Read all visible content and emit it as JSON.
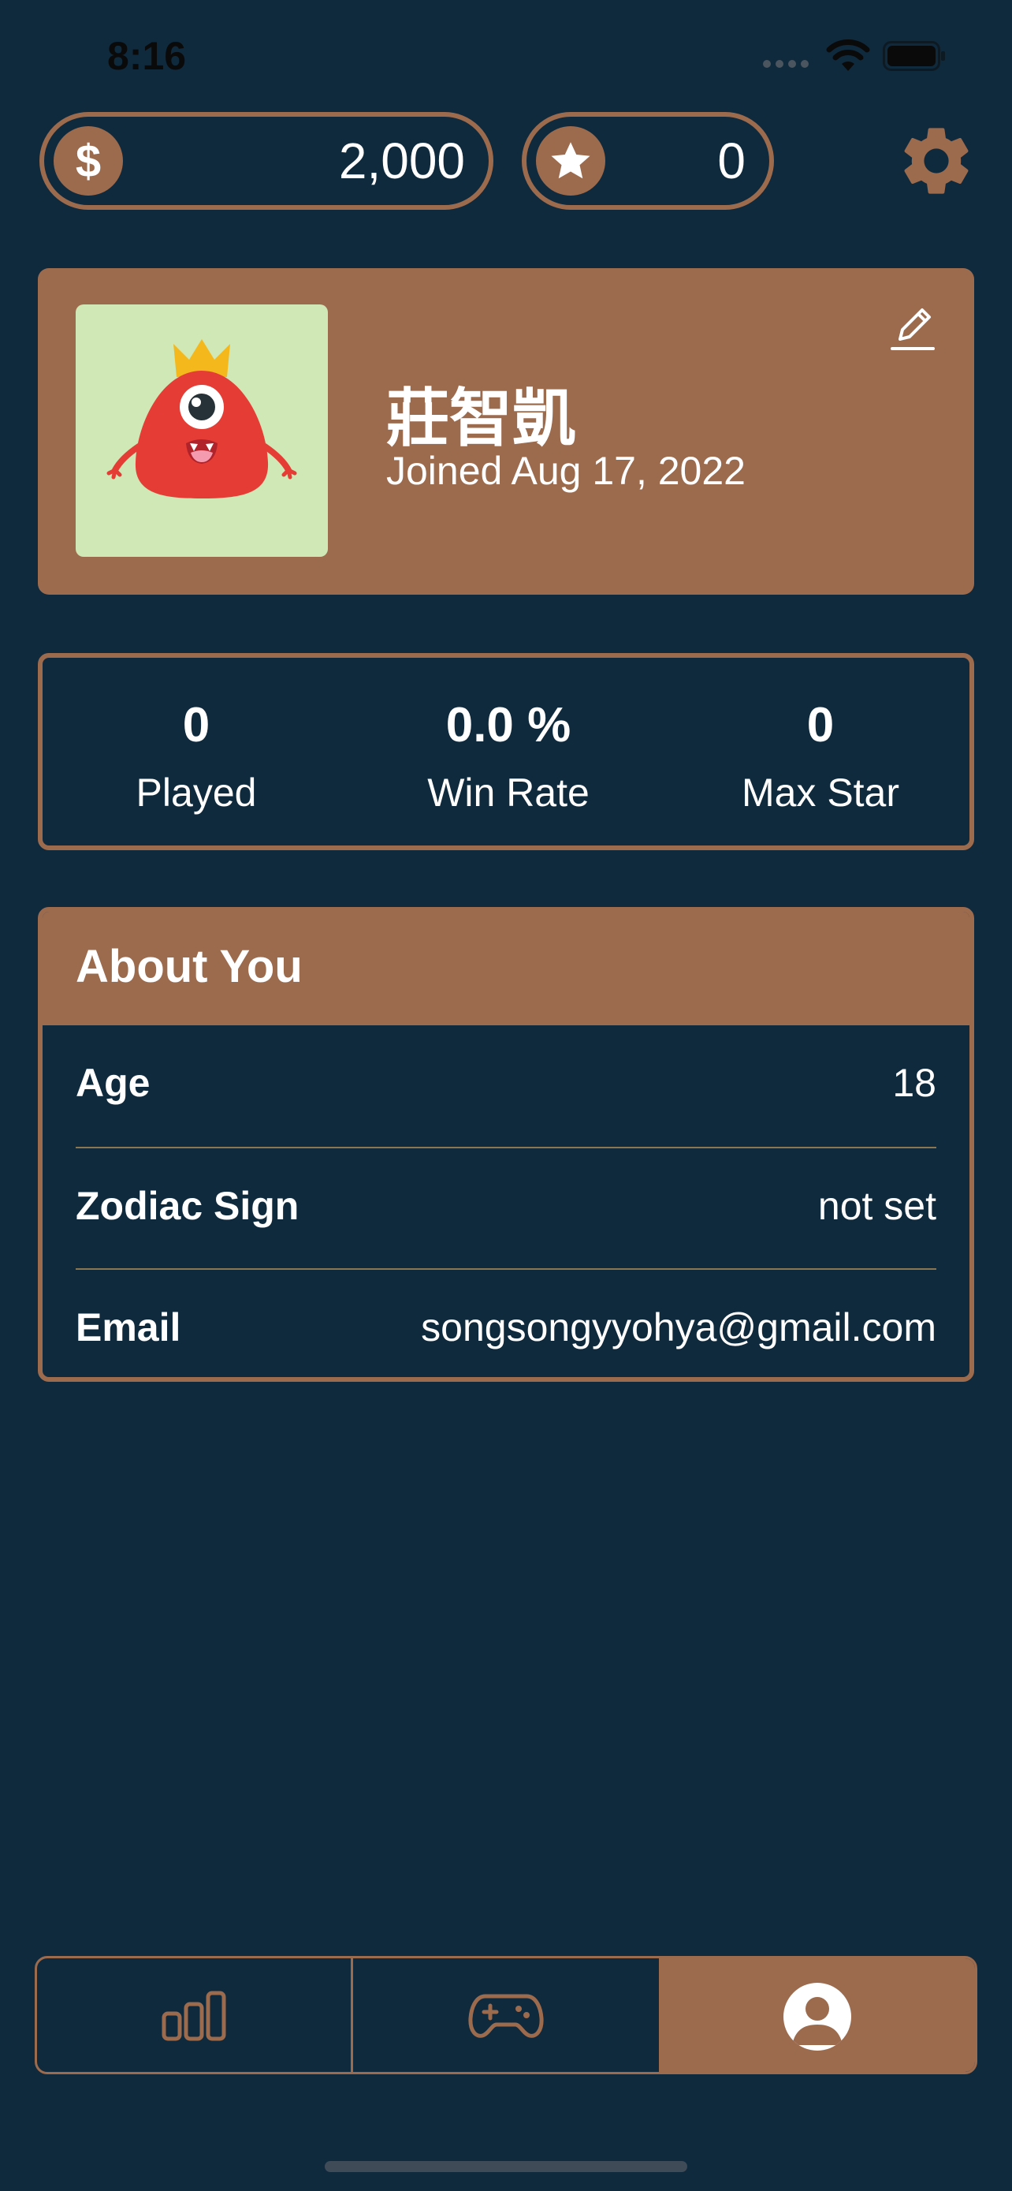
{
  "status_bar": {
    "time": "8:16",
    "icons": [
      "cellular-dots-icon",
      "wifi-icon",
      "battery-icon"
    ]
  },
  "currency": {
    "coins": {
      "icon": "dollar-icon",
      "symbol": "$",
      "value": "2,000"
    },
    "stars": {
      "icon": "star-icon",
      "value": "0"
    },
    "settings_icon": "gear-icon"
  },
  "profile": {
    "name": "莊智凱",
    "joined": "Joined Aug 17, 2022",
    "avatar": "red-monster-avatar",
    "edit_icon": "pencil-icon"
  },
  "stats": [
    {
      "value": "0",
      "label": "Played"
    },
    {
      "value": "0.0 %",
      "label": "Win Rate"
    },
    {
      "value": "0",
      "label": "Max Star"
    }
  ],
  "about": {
    "title": "About You",
    "rows": [
      {
        "label": "Age",
        "value": "18"
      },
      {
        "label": "Zodiac Sign",
        "value": "not set"
      },
      {
        "label": "Email",
        "value": "songsongyyohya@gmail.com"
      }
    ]
  },
  "tabbar": {
    "tabs": [
      {
        "icon": "bar-chart-icon",
        "active": false
      },
      {
        "icon": "gamepad-icon",
        "active": false
      },
      {
        "icon": "profile-icon",
        "active": true
      }
    ]
  },
  "colors": {
    "background": "#102a3d",
    "accent": "#9c6b4e",
    "avatar_bg": "#cfe8b6",
    "monster_red": "#e53d35"
  }
}
